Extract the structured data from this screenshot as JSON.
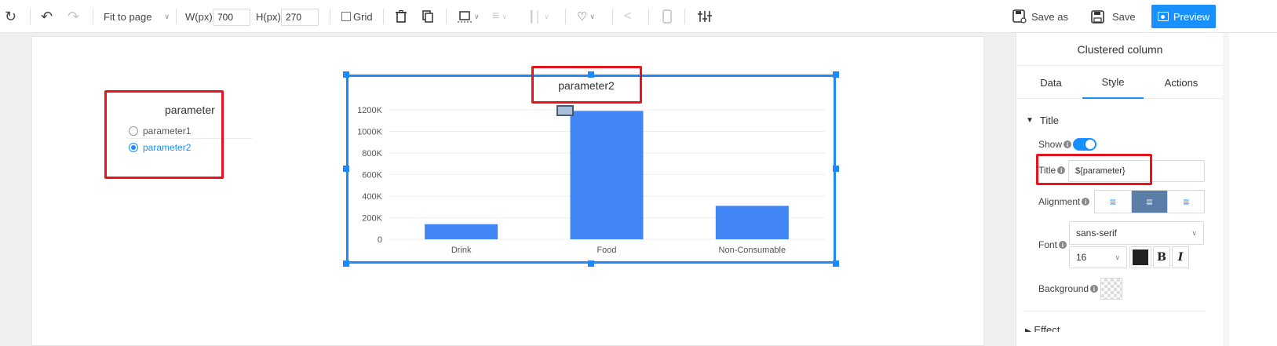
{
  "toolbar": {
    "refresh_icon": "refresh-icon",
    "undo_icon": "undo-icon",
    "redo_icon": "redo-icon",
    "zoom_value": "Fit to page",
    "width_label": "W(px)",
    "width_value": "700",
    "height_label": "H(px)",
    "height_value": "270",
    "grid_label": "Grid",
    "save_as_label": "Save as",
    "save_label": "Save",
    "preview_label": "Preview"
  },
  "parameter_widget": {
    "title": "parameter",
    "options": [
      {
        "label": "parameter1",
        "selected": false
      },
      {
        "label": "parameter2",
        "selected": true
      }
    ]
  },
  "chart_data": {
    "type": "bar",
    "title": "parameter2",
    "categories": [
      "Drink",
      "Food",
      "Non-Consumable"
    ],
    "values": [
      140000,
      1190000,
      310000
    ],
    "ytick_labels": [
      "0",
      "200K",
      "400K",
      "600K",
      "800K",
      "1000K",
      "1200K"
    ],
    "ylim": [
      0,
      1200000
    ],
    "color": "#4285f4",
    "grid": true,
    "xlabel": "",
    "ylabel": ""
  },
  "panel": {
    "header": "Clustered column",
    "tabs": [
      "Data",
      "Style",
      "Actions"
    ],
    "active_tab": "Style",
    "section_title": "Title",
    "show_label": "Show",
    "title_label": "Title",
    "title_value": "${parameter}",
    "alignment_label": "Alignment",
    "font_label": "Font",
    "font_family": "sans-serif",
    "font_size": "16",
    "bold_label": "B",
    "italic_label": "I",
    "background_label": "Background",
    "next_section": "Effect"
  },
  "colors": {
    "accent": "#1890ff",
    "highlight_box": "#e8131b",
    "bar": "#4285f4"
  }
}
